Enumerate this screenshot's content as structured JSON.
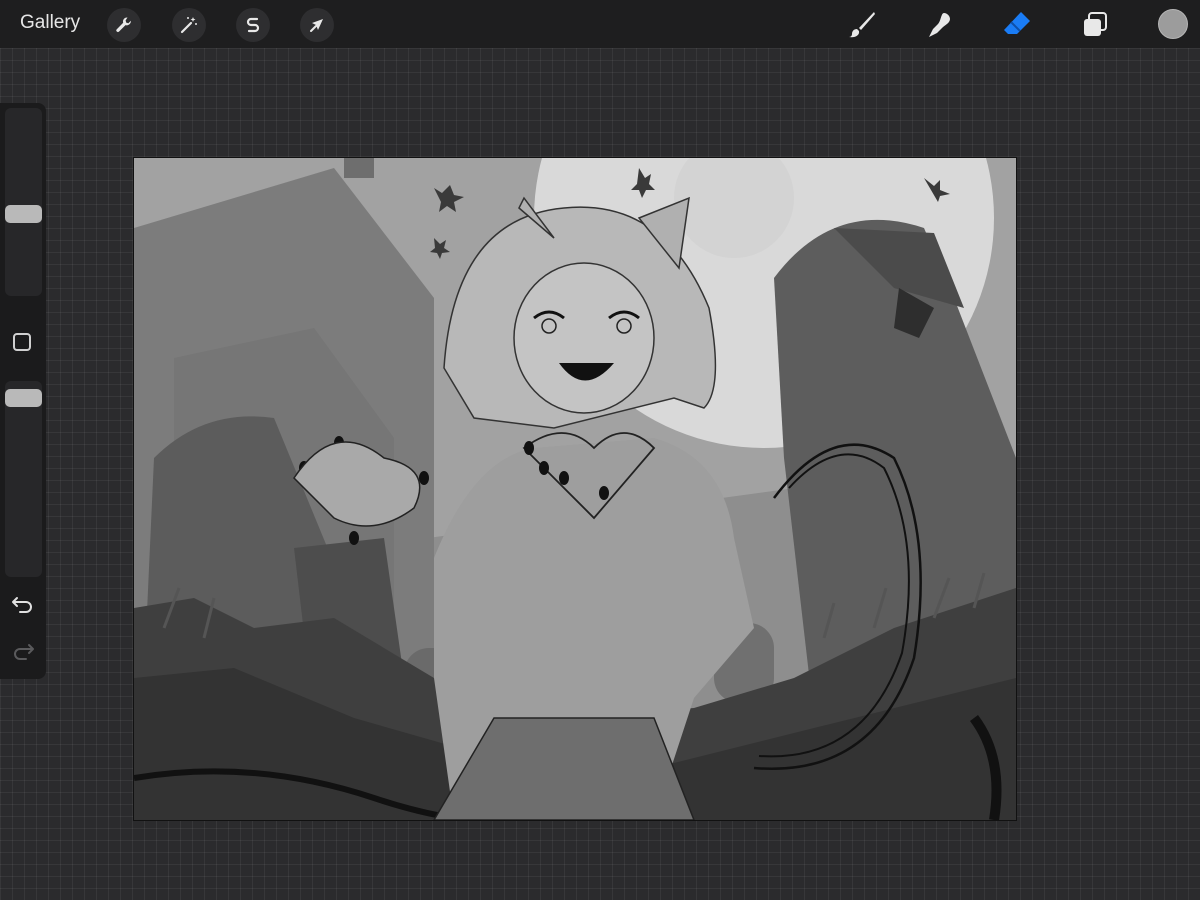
{
  "topbar": {
    "gallery_label": "Gallery",
    "left_tools": [
      {
        "name": "actions",
        "icon": "wrench-icon"
      },
      {
        "name": "adjustments",
        "icon": "magic-wand-icon"
      },
      {
        "name": "selection",
        "icon": "selection-s-icon"
      },
      {
        "name": "transform",
        "icon": "arrow-cursor-icon"
      }
    ],
    "right_tools": [
      {
        "name": "brush",
        "icon": "brush-icon",
        "active": false
      },
      {
        "name": "smudge",
        "icon": "smudge-icon",
        "active": false
      },
      {
        "name": "eraser",
        "icon": "eraser-icon",
        "active": true
      },
      {
        "name": "layers",
        "icon": "layers-icon",
        "active": false
      }
    ],
    "current_color": "#9c9c9c",
    "active_tool_color": "#1a7cf5"
  },
  "sidebar": {
    "brush_size_level": 0.5,
    "opacity_level": 0.95,
    "buttons": [
      "modify-button",
      "undo-icon",
      "redo-icon"
    ]
  },
  "canvas": {
    "description_colors": {
      "moon": "#d8d8d8",
      "sky": "#9a9a9a",
      "ground": "#3a3a3a"
    }
  }
}
